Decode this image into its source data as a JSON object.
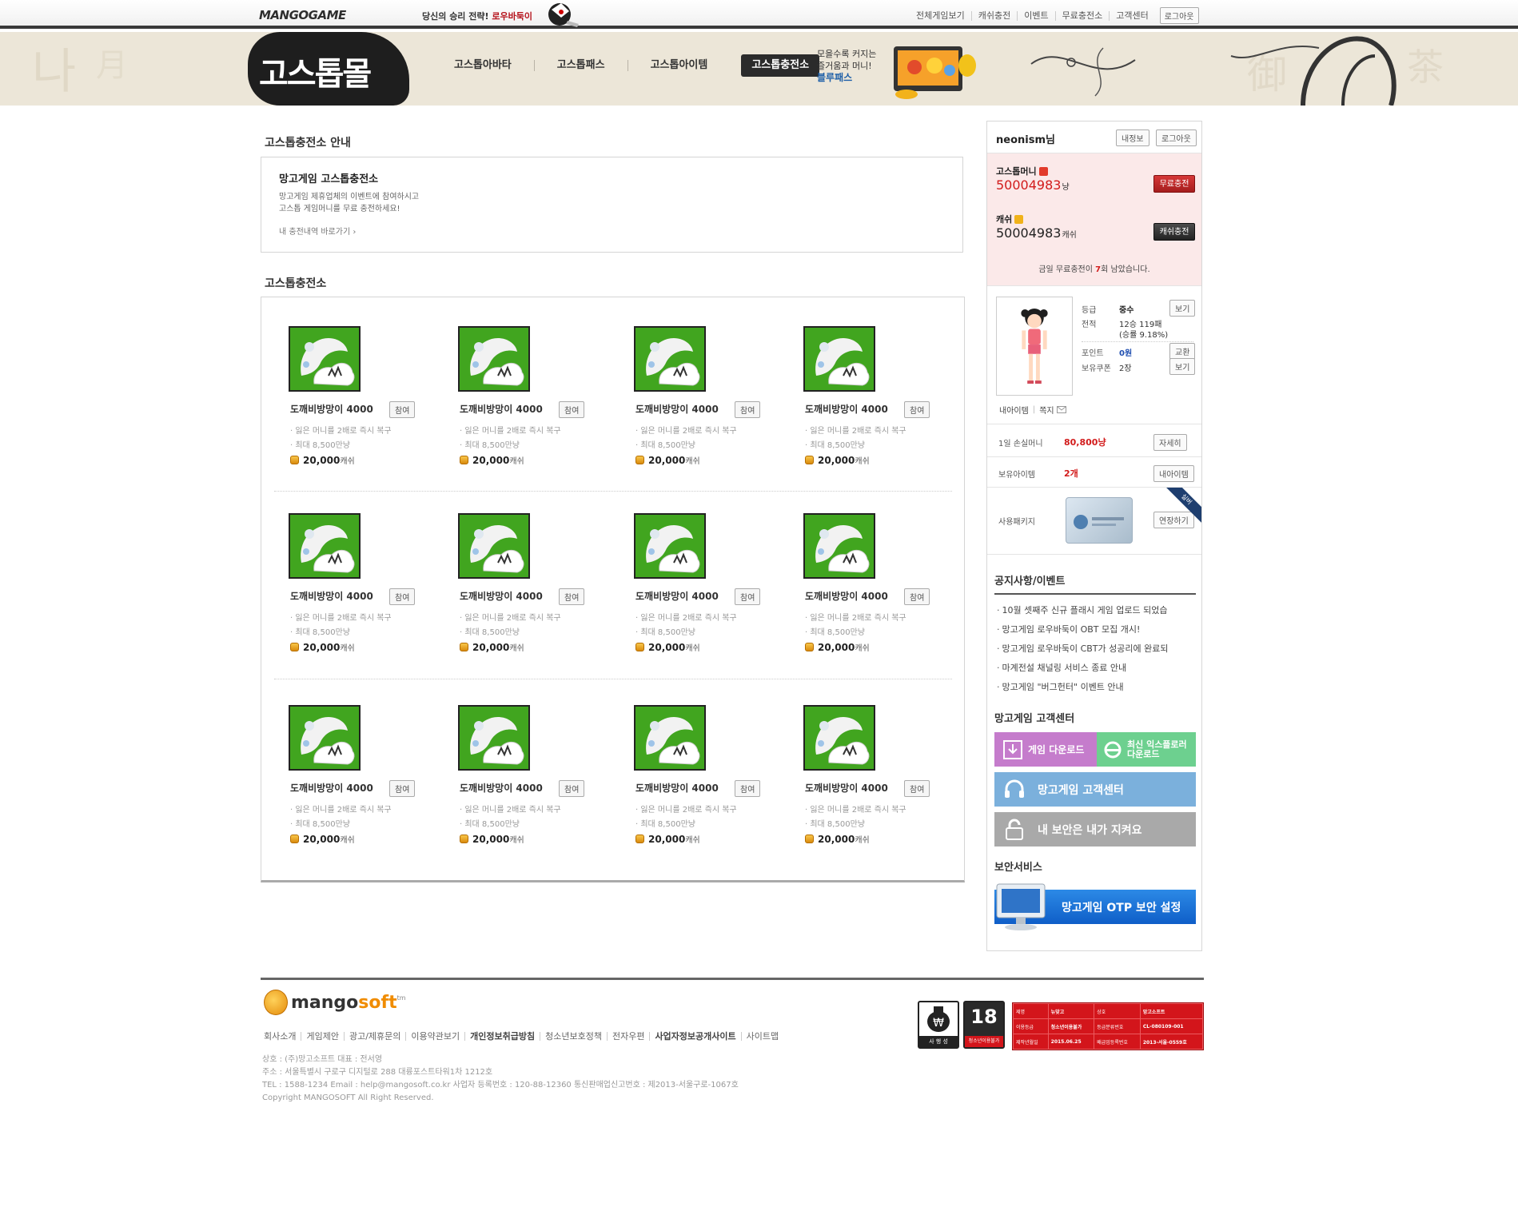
{
  "topbar": {
    "logo": "MANGOGAME",
    "promo_text": "당신의 승리 전략!",
    "promo_game": "로우바둑이",
    "nav": [
      "전체게임보기",
      "캐쉬충전",
      "이벤트",
      "무료충전소",
      "고객센터"
    ],
    "logout": "로그아웃"
  },
  "mall": {
    "logo": "고스톱몰",
    "nav": [
      "고스톱아바타",
      "고스톱패스",
      "고스톱아이템",
      "고스톱충전소"
    ],
    "active_index": 3,
    "bluepass_line1": "모을수록 커지는",
    "bluepass_line2": "즐거움과 머니!",
    "bluepass_name": "블루패스"
  },
  "guide": {
    "section_title": "고스톱충전소 안내",
    "box_title": "망고게임 고스톱충전소",
    "desc_line1": "망고게임 제휴업체의 이벤트에 참여하시고",
    "desc_line2": "고스톱 게임머니를 무료 충전하세요!",
    "link": "내 충전내역 바로가기 ›"
  },
  "charge": {
    "section_title": "고스톱충전소",
    "items": [
      {
        "name": "도깨비방망이 4000",
        "join": "참여",
        "desc1": "· 잃은 머니를 2배로 즉시 복구",
        "desc2": "· 최대 8,500만냥",
        "price": "20,000",
        "unit": "캐쉬"
      },
      {
        "name": "도깨비방망이 4000",
        "join": "참여",
        "desc1": "· 잃은 머니를 2배로 즉시 복구",
        "desc2": "· 최대 8,500만냥",
        "price": "20,000",
        "unit": "캐쉬"
      },
      {
        "name": "도깨비방망이 4000",
        "join": "참여",
        "desc1": "· 잃은 머니를 2배로 즉시 복구",
        "desc2": "· 최대 8,500만냥",
        "price": "20,000",
        "unit": "캐쉬"
      },
      {
        "name": "도깨비방망이 4000",
        "join": "참여",
        "desc1": "· 잃은 머니를 2배로 즉시 복구",
        "desc2": "· 최대 8,500만냥",
        "price": "20,000",
        "unit": "캐쉬"
      },
      {
        "name": "도깨비방망이 4000",
        "join": "참여",
        "desc1": "· 잃은 머니를 2배로 즉시 복구",
        "desc2": "· 최대 8,500만냥",
        "price": "20,000",
        "unit": "캐쉬"
      },
      {
        "name": "도깨비방망이 4000",
        "join": "참여",
        "desc1": "· 잃은 머니를 2배로 즉시 복구",
        "desc2": "· 최대 8,500만냥",
        "price": "20,000",
        "unit": "캐쉬"
      },
      {
        "name": "도깨비방망이 4000",
        "join": "참여",
        "desc1": "· 잃은 머니를 2배로 즉시 복구",
        "desc2": "· 최대 8,500만냥",
        "price": "20,000",
        "unit": "캐쉬"
      },
      {
        "name": "도깨비방망이 4000",
        "join": "참여",
        "desc1": "· 잃은 머니를 2배로 즉시 복구",
        "desc2": "· 최대 8,500만냥",
        "price": "20,000",
        "unit": "캐쉬"
      },
      {
        "name": "도깨비방망이 4000",
        "join": "참여",
        "desc1": "· 잃은 머니를 2배로 즉시 복구",
        "desc2": "· 최대 8,500만냥",
        "price": "20,000",
        "unit": "캐쉬"
      },
      {
        "name": "도깨비방망이 4000",
        "join": "참여",
        "desc1": "· 잃은 머니를 2배로 즉시 복구",
        "desc2": "· 최대 8,500만냥",
        "price": "20,000",
        "unit": "캐쉬"
      },
      {
        "name": "도깨비방망이 4000",
        "join": "참여",
        "desc1": "· 잃은 머니를 2배로 즉시 복구",
        "desc2": "· 최대 8,500만냥",
        "price": "20,000",
        "unit": "캐쉬"
      },
      {
        "name": "도깨비방망이 4000",
        "join": "참여",
        "desc1": "· 잃은 머니를 2배로 즉시 복구",
        "desc2": "· 최대 8,500만냥",
        "price": "20,000",
        "unit": "캐쉬"
      }
    ]
  },
  "sidebar": {
    "username": "neonism님",
    "myinfo_btn": "내정보",
    "logout_btn": "로그아웃",
    "gostop_money_label": "고스톱머니",
    "gostop_money": "50004983",
    "gostop_money_unit": "냥",
    "free_charge_btn": "무료충전",
    "cash_label": "캐쉬",
    "cash": "50004983",
    "cash_unit": "캐쉬",
    "cash_charge_btn": "캐쉬충전",
    "free_note_pre": "금일 무료충전이 ",
    "free_note_count": "7",
    "free_note_post": "회 남았습니다.",
    "grade_label": "등급",
    "grade_value": "중수",
    "record_label": "전적",
    "record_value1": "12승 119패",
    "record_value2": "(승률 9.18%)",
    "point_label": "포인트",
    "point_value": "0원",
    "coupon_label": "보유쿠폰",
    "coupon_value": "2장",
    "view_btn": "보기",
    "exchange_btn": "교환",
    "myitem": "내아이템",
    "memo": "쪽지",
    "daily_loss_label": "1일 손실머니",
    "daily_loss_value": "80,800냥",
    "detail_btn": "자세히",
    "items_label": "보유아이템",
    "items_value": "2개",
    "myitems_btn": "내아이템",
    "package_label": "사용패키지",
    "extend_btn": "연장하기",
    "package_ribbon": "실버",
    "notice_title": "공지사항/이벤트",
    "notices": [
      "10월 셋째주 신규 플래시 게임 업로드 되었습",
      "망고게임 로우바둑이 OBT 모집 개시!",
      "망고게임 로우바둑이 CBT가 성공리에 완료되",
      "마계전설 채널링 서비스 종료 안내",
      "망고게임 \"버그헌터\" 이벤트 안내"
    ],
    "cs_title": "망고게임 고객센터",
    "banner_download": "게임 다운로드",
    "banner_ie_line1": "최신 익스플로러",
    "banner_ie_line2": "다운로드",
    "banner_cs": "망고게임 고객센터",
    "banner_security": "내 보안은 내가 지켜요",
    "security_title": "보안서비스",
    "banner_otp": "망고게임 OTP 보안 설정"
  },
  "footer": {
    "logo_main": "mango",
    "logo_soft": "soft",
    "logo_tm": "tm",
    "nav": [
      "회사소개",
      "게임제안",
      "광고/제휴문의",
      "이용약관보기",
      "개인정보취급방침",
      "청소년보호정책",
      "전자우편",
      "사업자정보공개사이트",
      "사이트맵"
    ],
    "info1": "상호 : (주)망고소프트 대표 : 전서영",
    "info2": "주소 : 서울특별시 구로구 디지털로 288 대륭포스트타워1차 1212호",
    "info3": "TEL : 1588-1234 Email : help@mangosoft.co.kr 사업자 등록번호 : 120-88-12360 통신판매업신고번호 : 제2013-서울구로-1067호",
    "copyright": "Copyright MANGOSOFT All Right Reserved.",
    "rating_label1": "사 행 성",
    "rating_label2": "청소년이용불가",
    "rating_age": "18",
    "rating_table": {
      "r1": [
        "제명",
        "뉴맞고",
        "상호",
        "망고소프트"
      ],
      "r2": [
        "이용등급",
        "청소년이용불가",
        "등급분류번호",
        "CL-080109-001"
      ],
      "r3": [
        "제작년월일",
        "2015.06.25",
        "배급업등록번호",
        "2013-서울-0559호"
      ]
    }
  }
}
